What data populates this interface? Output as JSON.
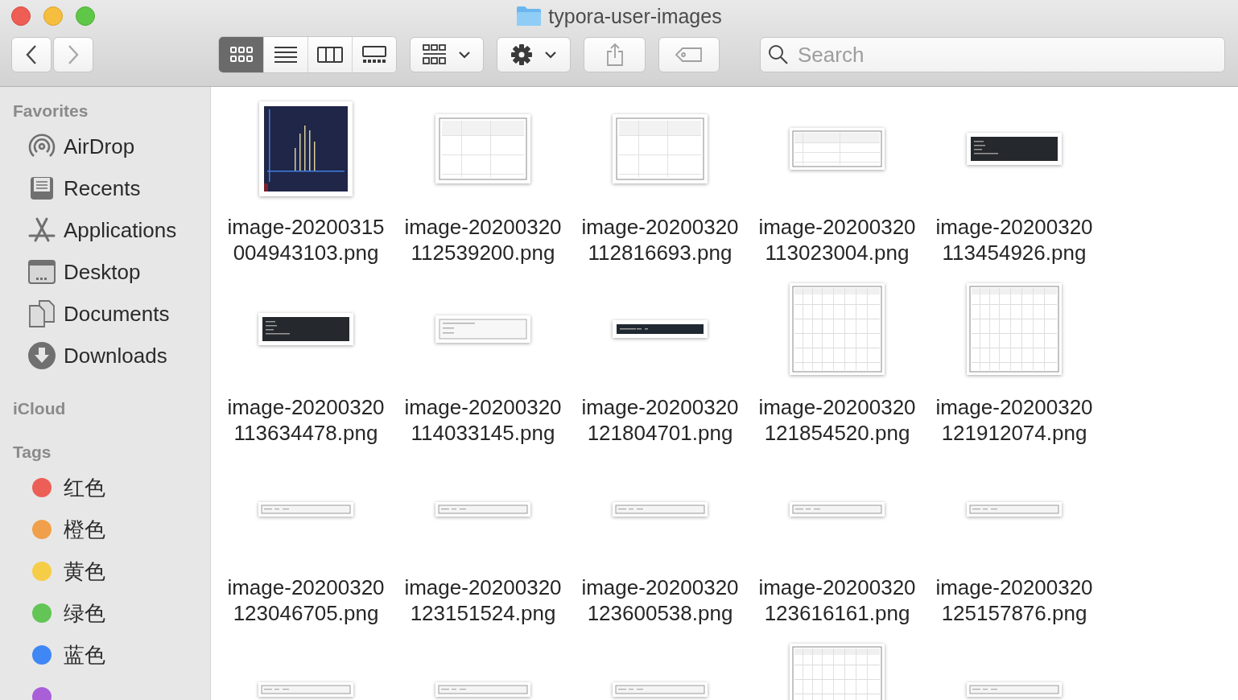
{
  "window": {
    "title": "typora-user-images"
  },
  "toolbar": {
    "nav": [
      {
        "kind": "back",
        "disabled": false
      },
      {
        "kind": "forward",
        "disabled": true
      }
    ],
    "view_modes": [
      {
        "kind": "icons",
        "selected": true
      },
      {
        "kind": "list",
        "selected": false
      },
      {
        "kind": "columns",
        "selected": false
      },
      {
        "kind": "gallery",
        "selected": false
      }
    ],
    "actions": [
      {
        "kind": "group",
        "disabled": false
      },
      {
        "kind": "action",
        "disabled": false
      },
      {
        "kind": "share",
        "disabled": true
      },
      {
        "kind": "tag",
        "disabled": true
      }
    ],
    "search": {
      "placeholder": "Search"
    }
  },
  "sidebar": {
    "sections": [
      {
        "title": "Favorites",
        "items": [
          {
            "label": "AirDrop",
            "kind": "airdrop"
          },
          {
            "label": "Recents",
            "kind": "recents"
          },
          {
            "label": "Applications",
            "kind": "applications"
          },
          {
            "label": "Desktop",
            "kind": "desktop"
          },
          {
            "label": "Documents",
            "kind": "documents"
          },
          {
            "label": "Downloads",
            "kind": "downloads"
          }
        ]
      },
      {
        "title": "iCloud"
      },
      {
        "title": "Tags",
        "items": [
          {
            "label": "红色",
            "color": "#ec5f57"
          },
          {
            "label": "橙色",
            "color": "#f0a04a"
          },
          {
            "label": "黄色",
            "color": "#f5cd47"
          },
          {
            "label": "绿色",
            "color": "#62c555"
          },
          {
            "label": "蓝色",
            "color": "#3f87f5"
          },
          {
            "color": "#a95fd8"
          }
        ]
      }
    ]
  },
  "files": [
    {
      "name": "image-20200315004943103.png",
      "kind": "picture"
    },
    {
      "name": "image-20200320112539200.png",
      "kind": "picture"
    },
    {
      "name": "image-20200320112816693.png",
      "kind": "picture"
    },
    {
      "name": "image-20200320113023004.png",
      "kind": "picture"
    },
    {
      "name": "image-20200320113454926.png",
      "kind": "picture"
    },
    {
      "name": "image-20200320113634478.png",
      "kind": "picture"
    },
    {
      "name": "image-20200320114033145.png",
      "kind": "picture"
    },
    {
      "name": "image-20200320121804701.png",
      "kind": "picture"
    },
    {
      "name": "image-20200320121854520.png",
      "kind": "picture"
    },
    {
      "name": "image-20200320121912074.png",
      "kind": "picture"
    },
    {
      "name": "image-20200320123046705.png",
      "kind": "picture"
    },
    {
      "name": "image-20200320123151524.png",
      "kind": "picture"
    },
    {
      "name": "image-20200320123600538.png",
      "kind": "picture"
    },
    {
      "name": "image-20200320123616161.png",
      "kind": "picture"
    },
    {
      "name": "image-20200320125157876.png",
      "kind": "picture"
    },
    {
      "kind": "picture"
    },
    {
      "kind": "picture"
    },
    {
      "kind": "picture"
    },
    {
      "kind": "picture"
    },
    {
      "kind": "picture"
    }
  ]
}
